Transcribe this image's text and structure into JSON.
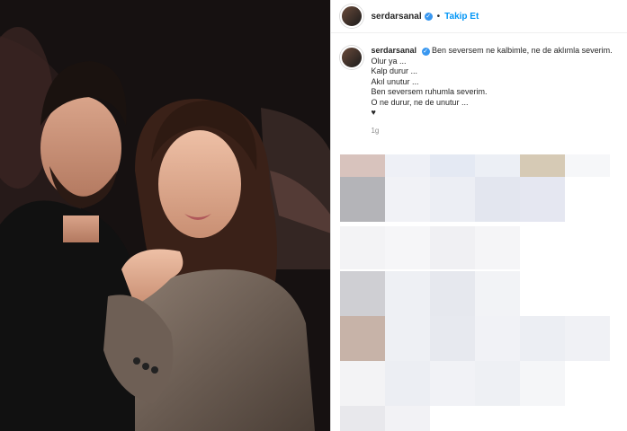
{
  "post": {
    "username": "serdarsanal",
    "follow_label": "Takip Et",
    "separator": "•",
    "verified_glyph": "✓",
    "caption_lines": [
      "Ben seversem ne kalbimle, ne de aklımla severim.",
      "Olur ya ...",
      "Kalp durur ...",
      "Akıl unutur ...",
      "Ben seversem ruhumla severim.",
      "O ne durur, ne de unutur ...",
      "♥"
    ],
    "timestamp": "1g"
  },
  "colors": {
    "accent": "#0095f6",
    "verified": "#3897f0",
    "text": "#262626",
    "muted": "#8e8e8e"
  },
  "icons": [
    "avatar",
    "verified-badge-icon",
    "heart-icon"
  ]
}
